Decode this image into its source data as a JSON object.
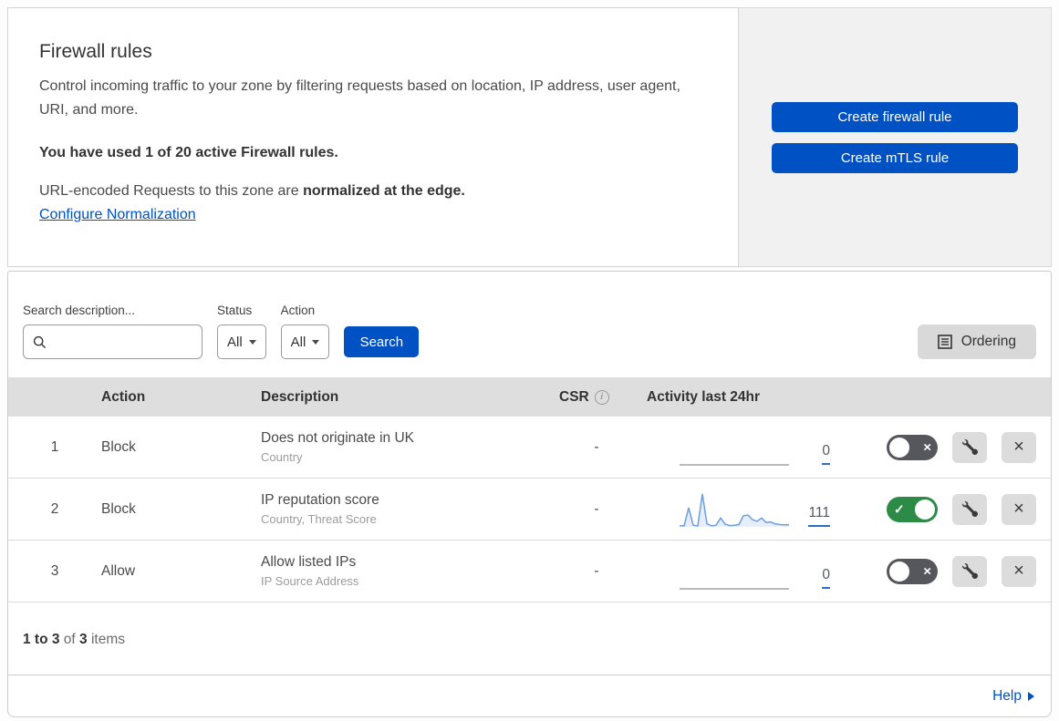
{
  "header": {
    "title": "Firewall rules",
    "description": "Control incoming traffic to your zone by filtering requests based on location, IP address, user agent, URI, and more.",
    "usage": "You have used 1 of 20 active Firewall rules.",
    "normalization_text": "URL-encoded Requests to this zone are ",
    "normalization_bold": "normalized at the edge.",
    "normalization_link": "Configure Normalization",
    "buttons": {
      "create_firewall": "Create firewall rule",
      "create_mtls": "Create mTLS rule"
    }
  },
  "filters": {
    "search_label": "Search description...",
    "search_value": "",
    "status_label": "Status",
    "status_value": "All",
    "action_label": "Action",
    "action_value": "All",
    "search_button": "Search",
    "ordering_button": "Ordering"
  },
  "table": {
    "columns": {
      "action": "Action",
      "description": "Description",
      "csr": "CSR",
      "activity": "Activity last 24hr"
    },
    "rows": [
      {
        "priority": "1",
        "action": "Block",
        "description": "Does not originate in UK",
        "fields": "Country",
        "csr": "-",
        "activity_count": "0",
        "enabled": false,
        "sparkline": []
      },
      {
        "priority": "2",
        "action": "Block",
        "description": "IP reputation score",
        "fields": "Country, Threat Score",
        "csr": "-",
        "activity_count": "111",
        "enabled": true,
        "sparkline": [
          3,
          3,
          58,
          5,
          3,
          100,
          10,
          3,
          5,
          27,
          8,
          4,
          5,
          7,
          34,
          36,
          22,
          17,
          27,
          13,
          15,
          9,
          7,
          6,
          6
        ]
      },
      {
        "priority": "3",
        "action": "Allow",
        "description": "Allow listed IPs",
        "fields": "IP Source Address",
        "csr": "-",
        "activity_count": "0",
        "enabled": false,
        "sparkline": []
      }
    ]
  },
  "footer": {
    "range": "1 to 3",
    "of_text": " of ",
    "total": "3",
    "items_text": " items"
  },
  "help": {
    "label": "Help"
  },
  "icons": {
    "search": "magnifier",
    "ordering": "document-list",
    "info": "i",
    "wrench": "wrench",
    "delete": "×",
    "toggle_on_glyph": "✓",
    "toggle_off_glyph": "×",
    "dropdown_caret": "caret-down",
    "help_arrow": "arrow-right"
  },
  "colors": {
    "accent_blue": "#0051c3",
    "toggle_on_green": "#2c8c47",
    "toggle_off_gray": "#55575c",
    "sparkline_blue": "#6d9ee0",
    "sparkline_fill": "#e6eefb",
    "flat_line_gray": "#a3a3a3",
    "table_header_bg": "#dedede",
    "panel_bg": "#f1f1f1"
  }
}
